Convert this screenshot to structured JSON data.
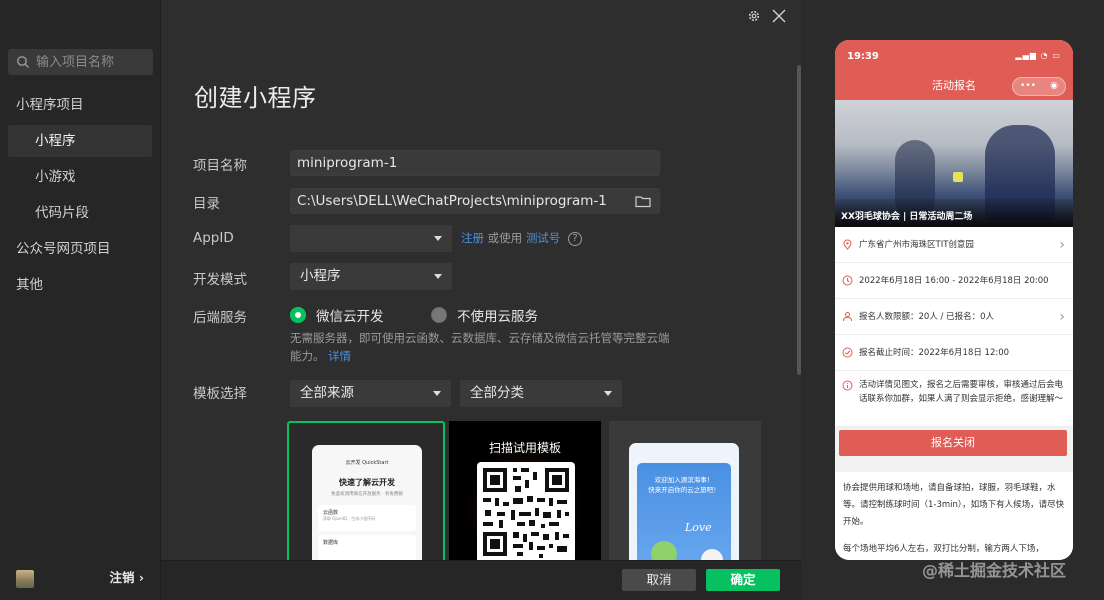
{
  "sidebar": {
    "search_placeholder": "输入项目名称",
    "items": [
      {
        "label": "小程序项目"
      },
      {
        "label": "小程序"
      },
      {
        "label": "小游戏"
      },
      {
        "label": "代码片段"
      },
      {
        "label": "公众号网页项目"
      },
      {
        "label": "其他"
      }
    ],
    "logout_label": "注销 ›"
  },
  "main": {
    "title": "创建小程序",
    "labels": {
      "project_name": "项目名称",
      "directory": "目录",
      "appid": "AppID",
      "dev_mode": "开发模式",
      "backend": "后端服务",
      "template": "模板选择"
    },
    "project_name_value": "miniprogram-1",
    "directory_value": "C:\\Users\\DELL\\WeChatProjects\\miniprogram-1",
    "appid_value": "",
    "appid_register": "注册",
    "appid_or_use": "或使用",
    "appid_test": "测试号",
    "dev_mode_value": "小程序",
    "backend_options": [
      {
        "label": "微信云开发",
        "selected": true
      },
      {
        "label": "不使用云服务",
        "selected": false
      }
    ],
    "backend_desc": "无需服务器，即可使用云函数、云数据库、云存储及微信云托管等完整云端能力。",
    "backend_detail_link": "详情",
    "template_source": "全部来源",
    "template_category": "全部分类",
    "templates": [
      {
        "title": "云开发 QuickStart",
        "heading": "快速了解云开发",
        "subtitle": "免鉴权调用微信开放服务 · 有免费额",
        "card1": "云函数",
        "card1_sub": "获取 OpenID、生成小程序码",
        "card2": "数据库"
      },
      {
        "title": "扫描试用模板"
      },
      {
        "line1": "欢迎加入源滨海事！",
        "line2": "快来开启你的云之旅吧！",
        "tag": "Love"
      }
    ]
  },
  "footer": {
    "cancel": "取消",
    "confirm": "确定"
  },
  "preview": {
    "time": "19:39",
    "nav_title": "活动报名",
    "capsule_more": "•••",
    "photo_caption": "XX羽毛球协会 | 日常活动周二场",
    "rows": [
      {
        "text": "广东省广州市海珠区TIT创意园",
        "chevron": true
      },
      {
        "text": "2022年6月18日 16:00 - 2022年6月18日 20:00",
        "chevron": false
      },
      {
        "text": "报名人数限额：20人 / 已报名：0人",
        "chevron": true
      },
      {
        "text": "报名截止时间：2022年6月18日 12:00",
        "chevron": false
      },
      {
        "text": "活动详情见图文，报名之后需要审核，审核通过后会电话联系你加群，如果人满了则会显示拒绝，感谢理解～",
        "chevron": false
      }
    ],
    "close_button": "报名关闭",
    "body_text": "协会提供用球和场地，请自备球拍，球服，羽毛球鞋，水等。请控制练球时间（1-3min），如场下有人候场，请尽快开始。",
    "body_text2": "每个场地平均6人左右，双打比分制，输方两人下场，"
  },
  "watermark": "@稀土掘金技术社区",
  "colors": {
    "accent": "#07c160",
    "link": "#4a90e2",
    "preview_red": "#e05d55"
  }
}
